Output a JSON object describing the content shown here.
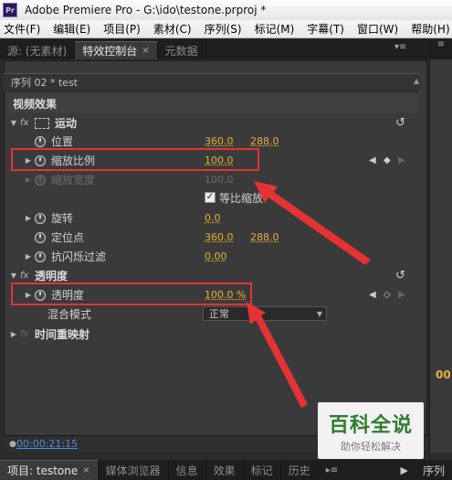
{
  "window": {
    "title": "Adobe Premiere Pro - G:\\ido\\testone.prproj *",
    "logo_text": "Pr"
  },
  "menu": [
    "文件(F)",
    "编辑(E)",
    "项目(P)",
    "素材(C)",
    "序列(S)",
    "标记(M)",
    "字幕(T)",
    "窗口(W)",
    "帮助(H)"
  ],
  "tabs": {
    "source": "源: (无素材)",
    "effect_controls": "特效控制台",
    "metadata": "元数据",
    "close": "×"
  },
  "panel": {
    "sequence_label": "序列 02 * test",
    "video_effects": "视频效果",
    "motion": {
      "name": "运动",
      "position": {
        "label": "位置",
        "x": "360.0",
        "y": "288.0"
      },
      "scale": {
        "label": "缩放比例",
        "value": "100.0"
      },
      "scale_width": {
        "label": "缩放宽度",
        "value": "100.0"
      },
      "uniform_scale": {
        "label": "等比缩放",
        "checked": true
      },
      "rotation": {
        "label": "旋转",
        "value": "0.0"
      },
      "anchor": {
        "label": "定位点",
        "x": "360.0",
        "y": "288.0"
      },
      "anti_flicker": {
        "label": "抗闪烁过滤",
        "value": "0.00"
      }
    },
    "opacity": {
      "name": "透明度",
      "opacity": {
        "label": "透明度",
        "value": "100.0 %"
      },
      "blend_mode": {
        "label": "混合模式",
        "value": "正常"
      }
    },
    "time_remap": {
      "name": "时间重映射"
    },
    "timecode": "00:00:21:15"
  },
  "right": {
    "timecode_partial": "00",
    "bottom_tab": "序列"
  },
  "bottom_tabs": [
    "项目: testone",
    "媒体浏览器",
    "信息",
    "效果",
    "标记",
    "历史"
  ],
  "watermark": {
    "title": "百科全说",
    "subtitle": "助你轻松解决"
  },
  "colors": {
    "value": "#e8b23b",
    "highlight": "#e53333",
    "timecode": "#4d8fe0",
    "watermark_green": "#2e7d32"
  }
}
